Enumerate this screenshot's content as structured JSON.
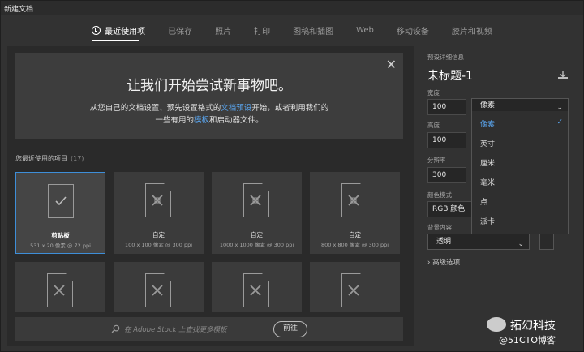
{
  "window": {
    "title": "新建文档"
  },
  "tabs": [
    {
      "label": "最近使用项"
    },
    {
      "label": "已保存"
    },
    {
      "label": "照片"
    },
    {
      "label": "打印"
    },
    {
      "label": "图稿和插图"
    },
    {
      "label": "Web"
    },
    {
      "label": "移动设备"
    },
    {
      "label": "胶片和视频"
    }
  ],
  "banner": {
    "title": "让我们开始尝试新事物吧。",
    "line1_a": "从您自己的文档设置、预先设置格式的",
    "line1_link": "文档预设",
    "line1_b": "开始，或者利用我们的",
    "line2_a": "一些有用的",
    "line2_link": "模板",
    "line2_b": "和启动器文件。"
  },
  "recent": {
    "label": "您最近使用的项目",
    "count": "(17)",
    "items": [
      {
        "name": "剪贴板",
        "size": "531 x 20 像素 @ 72 ppi"
      },
      {
        "name": "自定",
        "size": "100 x 100 像素 @ 300 ppi"
      },
      {
        "name": "自定",
        "size": "1000 x 1000 像素 @ 300 ppi"
      },
      {
        "name": "自定",
        "size": "800 x 800 像素 @ 300 ppi"
      }
    ]
  },
  "search": {
    "placeholder": "在 Adobe Stock 上查找更多模板",
    "button": "前往"
  },
  "details": {
    "section_label": "预设详细信息",
    "doc_title": "未标题-1",
    "width_label": "宽度",
    "width_value": "100",
    "unit_value": "像素",
    "height_label": "高度",
    "height_value": "100",
    "resolution_label": "分辨率",
    "resolution_value": "300",
    "color_mode_label": "颜色模式",
    "color_mode_value": "RGB 颜色",
    "background_label": "背景内容",
    "background_value": "透明",
    "advanced_label": "高级选项",
    "unit_options": [
      "像素",
      "英寸",
      "厘米",
      "毫米",
      "点",
      "派卡"
    ]
  },
  "watermark": {
    "title": "拓幻科技",
    "sub": "@51CTO博客"
  },
  "colors": {
    "accent": "#3e8ed8",
    "link": "#5aa6f0",
    "bg": "#323232"
  }
}
